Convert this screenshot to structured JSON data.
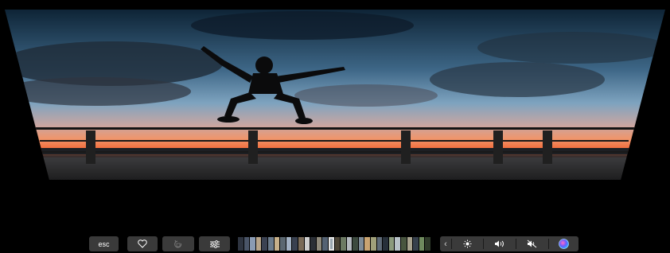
{
  "screen": {
    "content": "photo-silhouette-jumping-over-railing-at-sunset"
  },
  "touchbar": {
    "esc_label": "esc",
    "favorite_icon": "heart-icon",
    "rotate_icon": "rotate-icon",
    "adjust_icon": "sliders-icon",
    "filmstrip_colors": [
      "#2e3440",
      "#4a5568",
      "#8a9bb3",
      "#b8a58a",
      "#3b4252",
      "#6b7b8c",
      "#c7b08a",
      "#5b6770",
      "#a3b2c4",
      "#394150",
      "#7a6b58",
      "#cfcfcf",
      "#2b2f36",
      "#8f8a7c",
      "#546273",
      "#9aa7b1",
      "#4b4436",
      "#6c7a63",
      "#b4b9bf",
      "#3c4a3e",
      "#7d8b97",
      "#c9a472",
      "#a0a07a",
      "#5f6b78",
      "#27303a",
      "#8b9a7c",
      "#b8c2c8",
      "#48553f",
      "#a8a38f",
      "#36404c",
      "#6f8b5e",
      "#2f3b2a"
    ],
    "selected_index": 15,
    "collapse_icon": "chevron-left-icon",
    "brightness_icon": "brightness-icon",
    "volume_icon": "volume-icon",
    "mute_icon": "mute-icon",
    "siri_icon": "siri-icon"
  }
}
